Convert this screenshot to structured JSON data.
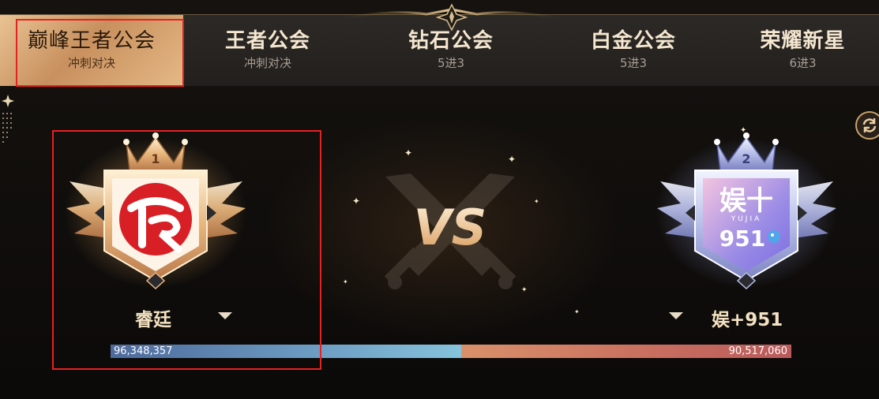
{
  "tabs": [
    {
      "title": "巅峰王者公会",
      "sub": "冲刺对决",
      "active": true
    },
    {
      "title": "王者公会",
      "sub": "冲刺对决",
      "active": false
    },
    {
      "title": "钻石公会",
      "sub": "5进3",
      "active": false
    },
    {
      "title": "白金公会",
      "sub": "5进3",
      "active": false
    },
    {
      "title": "荣耀新星",
      "sub": "6进3",
      "active": false
    }
  ],
  "match": {
    "left": {
      "rank": "1",
      "name": "睿廷",
      "score": "96,348,357",
      "logo_icon": "ruiting-logo"
    },
    "right": {
      "rank": "2",
      "name": "娱+951",
      "score": "90,517,060",
      "logo_icon": "yujia-951-logo",
      "logo_text_main": "娱十",
      "logo_text_small": "YUJIA",
      "logo_text_num": "951"
    },
    "vs_label": "VS",
    "score_split": 0.5156
  },
  "colors": {
    "gold": "#e9c394",
    "left_bar": "#6e9ec4",
    "right_bar": "#c86d5f",
    "highlight_red": "#e52222"
  },
  "icons": {
    "refresh": "refresh-icon",
    "caret": "chevron-down-icon"
  }
}
